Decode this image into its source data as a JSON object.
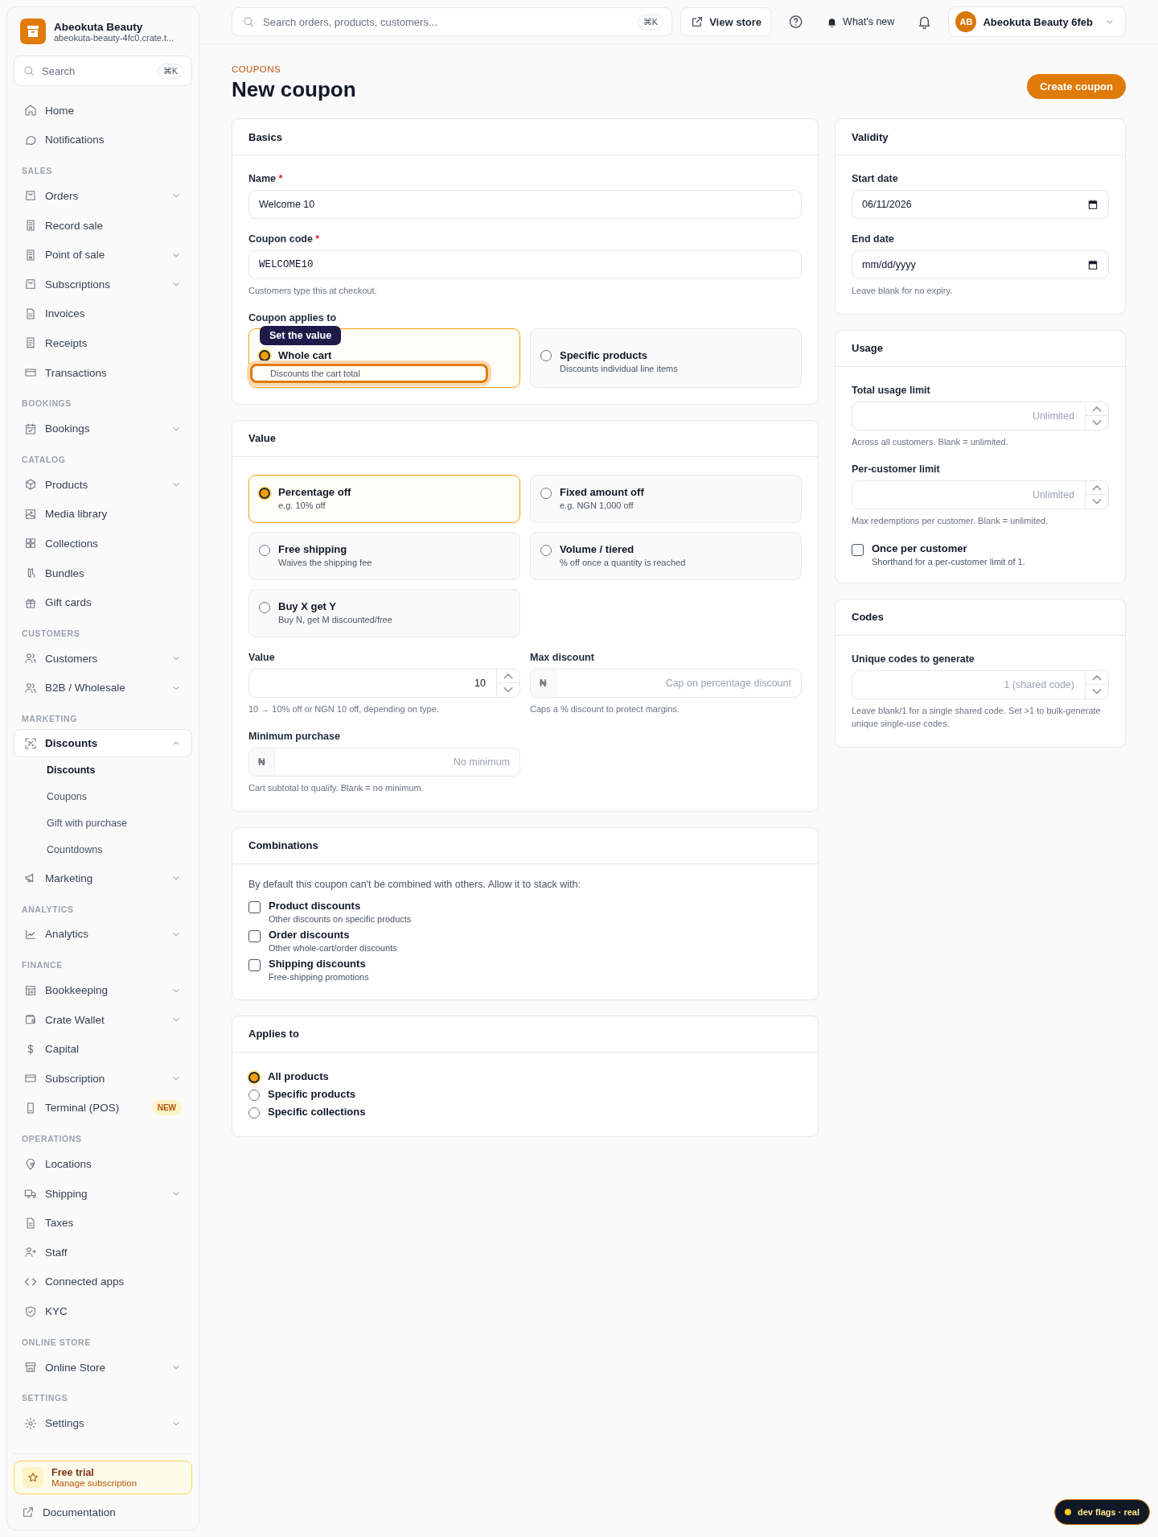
{
  "sidebar": {
    "store_name": "Abeokuta Beauty",
    "store_domain": "abeokuta-beauty-4fc0.crate.t...",
    "search": {
      "placeholder": "Search",
      "shortcut": "⌘K"
    },
    "sections": [
      {
        "items": [
          {
            "label": "Home",
            "selected": false
          },
          {
            "label": "Notifications",
            "selected": false
          }
        ]
      },
      {
        "title": "SALES",
        "items": [
          {
            "label": "Orders",
            "expanded": false,
            "selected": false
          },
          {
            "label": "Record sale",
            "selected": false
          },
          {
            "label": "Point of sale",
            "expanded": false,
            "selected": false
          },
          {
            "label": "Subscriptions",
            "expanded": false,
            "selected": false
          },
          {
            "label": "Invoices",
            "selected": false
          },
          {
            "label": "Receipts",
            "selected": false
          },
          {
            "label": "Transactions",
            "selected": false
          }
        ]
      },
      {
        "title": "BOOKINGS",
        "items": [
          {
            "label": "Bookings",
            "expanded": false,
            "selected": false
          }
        ]
      },
      {
        "title": "CATALOG",
        "items": [
          {
            "label": "Products",
            "expanded": false,
            "selected": false
          },
          {
            "label": "Media library",
            "selected": false
          },
          {
            "label": "Collections",
            "selected": false
          },
          {
            "label": "Bundles",
            "selected": false
          },
          {
            "label": "Gift cards",
            "selected": false
          }
        ]
      },
      {
        "title": "CUSTOMERS",
        "items": [
          {
            "label": "Customers",
            "expanded": false,
            "selected": false
          },
          {
            "label": "B2B / Wholesale",
            "expanded": false,
            "selected": false
          }
        ]
      },
      {
        "title": "MARKETING",
        "items": [
          {
            "label": "Discounts",
            "expanded": true,
            "selected": true,
            "children": [
              {
                "label": "Discounts",
                "selected": true
              },
              {
                "label": "Coupons",
                "selected": false
              },
              {
                "label": "Gift with purchase",
                "selected": false
              },
              {
                "label": "Countdowns",
                "selected": false
              }
            ]
          },
          {
            "label": "Marketing",
            "expanded": false,
            "selected": false
          }
        ]
      },
      {
        "title": "ANALYTICS",
        "items": [
          {
            "label": "Analytics",
            "expanded": false,
            "selected": false
          }
        ]
      },
      {
        "title": "FINANCE",
        "items": [
          {
            "label": "Bookkeeping",
            "expanded": false,
            "selected": false
          },
          {
            "label": "Crate Wallet",
            "expanded": false,
            "selected": false
          },
          {
            "label": "Capital",
            "selected": false
          },
          {
            "label": "Subscription",
            "expanded": false,
            "selected": false
          },
          {
            "label": "Terminal (POS)",
            "selected": false,
            "badge": "NEW"
          }
        ]
      },
      {
        "title": "OPERATIONS",
        "items": [
          {
            "label": "Locations",
            "selected": false
          },
          {
            "label": "Shipping",
            "expanded": false,
            "selected": false
          },
          {
            "label": "Taxes",
            "selected": false
          },
          {
            "label": "Staff",
            "selected": false
          },
          {
            "label": "Connected apps",
            "selected": false
          },
          {
            "label": "KYC",
            "selected": false
          }
        ]
      },
      {
        "title": "ONLINE STORE",
        "items": [
          {
            "label": "Online Store",
            "expanded": false,
            "selected": false
          }
        ]
      },
      {
        "title": "SETTINGS",
        "items": [
          {
            "label": "Settings",
            "expanded": false,
            "selected": false
          }
        ]
      }
    ],
    "trial": {
      "title": "Free trial",
      "subtitle": "Manage subscription"
    },
    "documentation": "Documentation"
  },
  "topbar": {
    "search": {
      "placeholder": "Search orders, products, customers...",
      "shortcut": "⌘K"
    },
    "view_store": "View store",
    "whats_new": "What's new",
    "account": {
      "initials": "AB",
      "name": "Abeokuta Beauty 6feb"
    }
  },
  "header": {
    "eyebrow": "COUPONS",
    "title": "New coupon",
    "primary_button": "Create coupon"
  },
  "basics": {
    "title": "Basics",
    "tooltip": "Set the value",
    "name": {
      "label": "Name",
      "required_mark": "*",
      "value": "Welcome 10"
    },
    "code": {
      "label": "Coupon code",
      "required_mark": "*",
      "value": "WELCOME10",
      "help": "Customers type this at checkout."
    },
    "applies": {
      "label": "Coupon applies to",
      "options": [
        {
          "title": "Whole cart",
          "description": "Discounts the cart total",
          "selected": true,
          "focused": true
        },
        {
          "title": "Specific products",
          "description": "Discounts individual line items",
          "selected": false,
          "focused": false
        }
      ]
    }
  },
  "value": {
    "title": "Value",
    "options": [
      {
        "title": "Percentage off",
        "description": "e.g. 10% off",
        "selected": true
      },
      {
        "title": "Fixed amount off",
        "description": "e.g. NGN 1,000 off",
        "selected": false
      },
      {
        "title": "Free shipping",
        "description": "Waives the shipping fee",
        "selected": false
      },
      {
        "title": "Volume / tiered",
        "description": "% off once a quantity is reached",
        "selected": false
      },
      {
        "title": "Buy X get Y",
        "description": "Buy N, get M discounted/free",
        "selected": false
      }
    ],
    "amount": {
      "label": "Value",
      "value": "10",
      "help": "10 → 10% off or NGN 10 off, depending on type."
    },
    "max_discount": {
      "label": "Max discount",
      "prefix": "₦",
      "placeholder": "Cap on percentage discount",
      "help": "Caps a % discount to protect margins."
    },
    "minimum": {
      "label": "Minimum purchase",
      "prefix": "₦",
      "placeholder": "No minimum",
      "help": "Cart subtotal to qualify. Blank = no minimum."
    }
  },
  "combinations": {
    "title": "Combinations",
    "intro": "By default this coupon can't be combined with others. Allow it to stack with:",
    "options": [
      {
        "title": "Product discounts",
        "description": "Other discounts on specific products",
        "checked": false
      },
      {
        "title": "Order discounts",
        "description": "Other whole-cart/order discounts",
        "checked": false
      },
      {
        "title": "Shipping discounts",
        "description": "Free-shipping promotions",
        "checked": false
      }
    ]
  },
  "applies_to": {
    "title": "Applies to",
    "options": [
      {
        "label": "All products",
        "selected": true
      },
      {
        "label": "Specific products",
        "selected": false
      },
      {
        "label": "Specific collections",
        "selected": false
      }
    ]
  },
  "validity": {
    "title": "Validity",
    "start": {
      "label": "Start date",
      "value": "06/11/2026"
    },
    "end": {
      "label": "End date",
      "placeholder": "mm/dd/yyyy",
      "help": "Leave blank for no expiry."
    }
  },
  "usage": {
    "title": "Usage",
    "total": {
      "label": "Total usage limit",
      "placeholder": "Unlimited",
      "help": "Across all customers. Blank = unlimited."
    },
    "per_customer": {
      "label": "Per-customer limit",
      "placeholder": "Unlimited",
      "help": "Max redemptions per customer. Blank = unlimited."
    },
    "once": {
      "title": "Once per customer",
      "description": "Shorthand for a per-customer limit of 1.",
      "checked": false
    }
  },
  "codes": {
    "title": "Codes",
    "unique": {
      "label": "Unique codes to generate",
      "placeholder": "1 (shared code)",
      "help": "Leave blank/1 for a single shared code. Set >1 to bulk-generate unique single-use codes."
    }
  },
  "dev_flags": "dev flags · real"
}
